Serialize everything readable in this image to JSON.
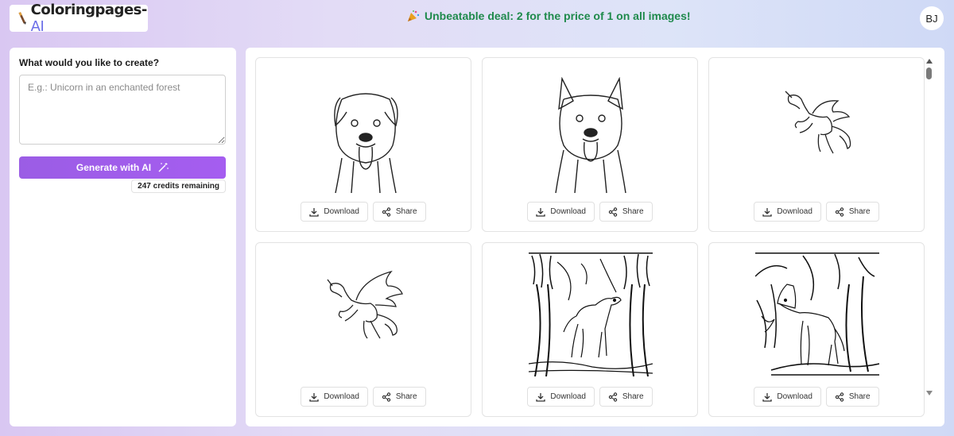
{
  "header": {
    "logo_text": "Coloringpages-",
    "logo_ai": "AI",
    "deal_text": "Unbeatable deal: 2 for the price of 1 on all images!",
    "avatar_initials": "BJ"
  },
  "sidebar": {
    "question": "What would you like to create?",
    "prompt_placeholder": "E.g.: Unicorn in an enchanted forest",
    "prompt_value": "",
    "generate_label": "Generate with AI",
    "credits_text": "247 credits remaining"
  },
  "gallery": {
    "download_label": "Download",
    "share_label": "Share",
    "images": [
      {
        "subject": "dog portrait"
      },
      {
        "subject": "german shepherd portrait"
      },
      {
        "subject": "winged unicorn"
      },
      {
        "subject": "winged unicorn"
      },
      {
        "subject": "dog in forest"
      },
      {
        "subject": "dog in forest"
      }
    ]
  },
  "colors": {
    "deal_green": "#1f8a4c",
    "button_purple": "#9b5de5",
    "logo_ai_blue": "#6b6ee8"
  },
  "icons": [
    "pencil-icon",
    "party-popper-icon",
    "magic-wand-icon",
    "download-icon",
    "share-icon"
  ]
}
